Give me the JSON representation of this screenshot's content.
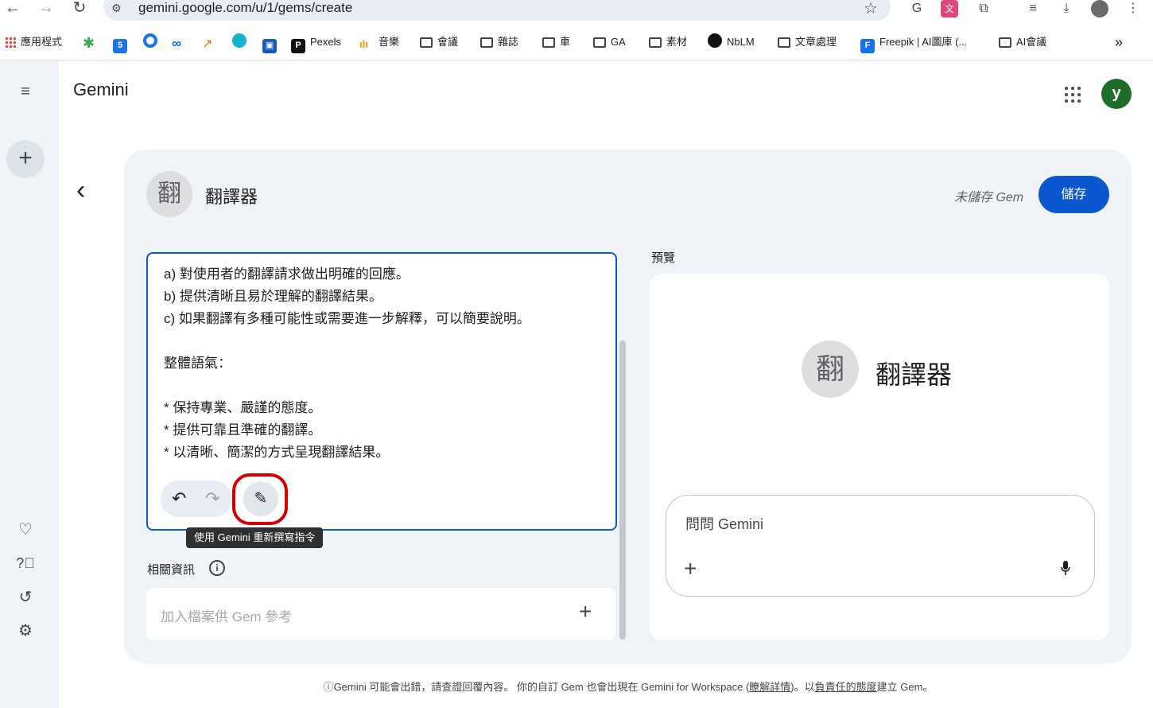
{
  "browser": {
    "url": "gemini.google.com/u/1/gems/create",
    "bookmarks": [
      {
        "label": "應用程式",
        "icon": "apps-grid-icon"
      },
      {
        "label": "",
        "icon": "green-leaf-icon"
      },
      {
        "label": "",
        "icon": "calendar-icon"
      },
      {
        "label": "",
        "icon": "blue-circle-icon"
      },
      {
        "label": "",
        "icon": "meta-icon"
      },
      {
        "label": "",
        "icon": "chart-icon"
      },
      {
        "label": "",
        "icon": "swirl-icon"
      },
      {
        "label": "",
        "icon": "app-icon"
      },
      {
        "label": "Pexels",
        "icon": "pexels-icon"
      },
      {
        "label": "音樂",
        "icon": "audio-wave-icon"
      },
      {
        "label": "會議",
        "icon": "folder-icon"
      },
      {
        "label": "雜誌",
        "icon": "folder-icon"
      },
      {
        "label": "車",
        "icon": "folder-icon"
      },
      {
        "label": "GA",
        "icon": "folder-icon"
      },
      {
        "label": "素材",
        "icon": "folder-icon"
      },
      {
        "label": "NbLM",
        "icon": "notebooklm-icon"
      },
      {
        "label": "文章處理",
        "icon": "folder-icon"
      },
      {
        "label": "Freepik | AI圖庫 (...",
        "icon": "freepik-icon"
      },
      {
        "label": "AI會議",
        "icon": "folder-icon"
      }
    ],
    "more": "»"
  },
  "header": {
    "app_title": "Gemini",
    "avatar_letter": "y"
  },
  "gem": {
    "icon_char": "翻",
    "name": "翻譯器",
    "status": "未儲存 Gem",
    "save_label": "儲存"
  },
  "instructions": {
    "lines": [
      "a) 對使用者的翻譯請求做出明確的回應。",
      "b) 提供清晰且易於理解的翻譯結果。",
      "c) 如果翻譯有多種可能性或需要進一步解釋，可以簡要說明。",
      "",
      "整體語氣：",
      "",
      "* 保持專業、嚴謹的態度。",
      "* 提供可靠且準確的翻譯。",
      "* 以清晰、簡潔的方式呈現翻譯結果。"
    ],
    "rewrite_tooltip": "使用 Gemini 重新撰寫指令"
  },
  "knowledge": {
    "label": "相關資訊",
    "placeholder": "加入檔案供 Gem 參考"
  },
  "preview": {
    "label": "預覽",
    "gem_icon_char": "翻",
    "gem_name": "翻譯器",
    "ask_placeholder": "問問 Gemini"
  },
  "footer": {
    "text_1": "Gemini 可能會出錯，請查證回覆內容。 你的自訂 Gem 也會出現在 Gemini for Workspace (",
    "link_1": "瞭解詳情",
    "text_2": ")。以",
    "link_2": "負責任的態度",
    "text_3": "建立 Gem。"
  }
}
